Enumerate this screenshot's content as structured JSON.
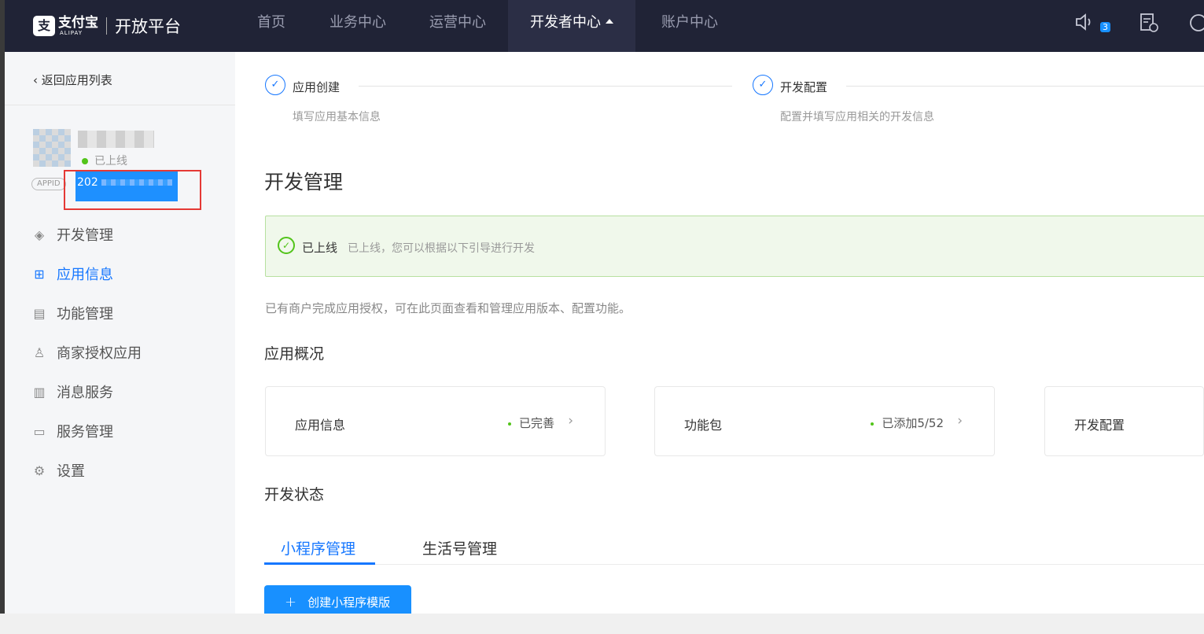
{
  "topbar": {
    "logo_mark": "支",
    "logo_cn": "支付宝",
    "logo_en": "ALIPAY",
    "platform": "开放平台",
    "nav": [
      {
        "label": "首页"
      },
      {
        "label": "业务中心"
      },
      {
        "label": "运营中心"
      },
      {
        "label": "开发者中心"
      },
      {
        "label": "账户中心"
      }
    ],
    "notification_count": "3",
    "icons": [
      "speaker-icon",
      "document-clock-icon",
      "help-icon"
    ]
  },
  "sidebar": {
    "back_label": "返回应用列表",
    "app_status": "已上线",
    "appid_tag": "APPID",
    "appid_value": "202",
    "menu": [
      {
        "label": "开发管理",
        "icon": "◈"
      },
      {
        "label": "应用信息",
        "icon": "⊞"
      },
      {
        "label": "功能管理",
        "icon": "▤"
      },
      {
        "label": "商家授权应用",
        "icon": "♙"
      },
      {
        "label": "消息服务",
        "icon": "▥"
      },
      {
        "label": "服务管理",
        "icon": "▭"
      },
      {
        "label": "设置",
        "icon": "⚙"
      }
    ]
  },
  "steps": [
    {
      "title": "应用创建",
      "desc": "填写应用基本信息",
      "mark": "✓"
    },
    {
      "title": "开发配置",
      "desc": "配置并填写应用相关的开发信息",
      "mark": "✓"
    }
  ],
  "main": {
    "page_title": "开发管理",
    "alert_title": "已上线",
    "alert_desc": "已上线，您可以根据以下引导进行开发",
    "alert_mark": "✓",
    "info_text": "已有商户完成应用授权，可在此页面查看和管理应用版本、配置功能。",
    "overview_title": "应用概况",
    "cards": [
      {
        "title": "应用信息",
        "status": "已完善",
        "arrow": "›"
      },
      {
        "title": "功能包",
        "status": "已添加5/52",
        "arrow": "›"
      },
      {
        "title": "开发配置"
      }
    ],
    "dev_status_title": "开发状态",
    "tabs": [
      {
        "label": "小程序管理"
      },
      {
        "label": "生活号管理"
      }
    ],
    "create_button": "创建小程序模版",
    "create_plus": "+"
  }
}
